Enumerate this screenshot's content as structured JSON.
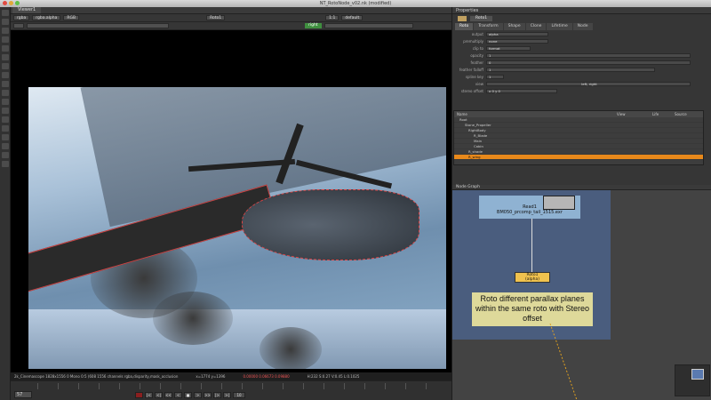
{
  "window_title": "NT_RotoNode_v02.nk (modified)",
  "viewer": {
    "tab": "Viewer1",
    "input_combo": "rgba",
    "channel_combo": "rgba.alpha",
    "colorspace_combo": "RGB",
    "node_combo": "Roto1",
    "zoom": "1:1",
    "lut": "default",
    "stereo_btn": "right",
    "info_format": "2k_Cinemascope 1828x1556 0  Mono  0:5  (608  1556 channels  rgba,disparity,mask_occlusion",
    "info_coords": "x=1774 y=1396",
    "info_values": "0.00000  0.06673  0.09880",
    "info_extra": "H:232 S:0.27 V:0.45 L:0.1025",
    "frame": "57",
    "playback": [
      "|<",
      "<|",
      "<<",
      "<",
      "■",
      ">",
      ">>",
      "|>",
      ">|"
    ],
    "step": "10"
  },
  "properties": {
    "title": "Properties",
    "node_name": "Roto1",
    "tabs": [
      "Roto",
      "Transform",
      "Shape",
      "Clone",
      "Lifetime",
      "Node"
    ],
    "active_tab": "Roto",
    "rows": [
      {
        "label": "output",
        "value": "alpha"
      },
      {
        "label": "premultiply",
        "value": "none"
      },
      {
        "label": "clip to",
        "value": "format"
      },
      {
        "label": "opacity",
        "value": "1"
      },
      {
        "label": "feather",
        "value": "0"
      },
      {
        "label": "feather falloff",
        "value": "1"
      },
      {
        "label": "spline key",
        "value": "1"
      },
      {
        "label": "view",
        "value": "left, right"
      },
      {
        "label": "stereo offset",
        "value": "x 0   y 0"
      }
    ],
    "tree_head": [
      "Name",
      "View",
      "Life",
      "Source"
    ],
    "tree_rows": [
      {
        "name": "Root",
        "selected": false
      },
      {
        "name": "Stone_Propeller",
        "selected": false
      },
      {
        "name": "RightBody",
        "selected": false
      },
      {
        "name": "R_Blade",
        "selected": false
      },
      {
        "name": "Main",
        "selected": false
      },
      {
        "name": "Cabin",
        "selected": false
      },
      {
        "name": "R_shade",
        "selected": false
      },
      {
        "name": "R_wing",
        "selected": true
      }
    ]
  },
  "nodegraph": {
    "tab": "Node Graph",
    "read_label": "Read1",
    "read_file": "BM050_prcomp_tail_1515.exr",
    "roto_label": "Roto1",
    "roto_channel": "(alpha)",
    "sticky_note": "Roto different parallax planes within the same roto with Stereo offset"
  }
}
